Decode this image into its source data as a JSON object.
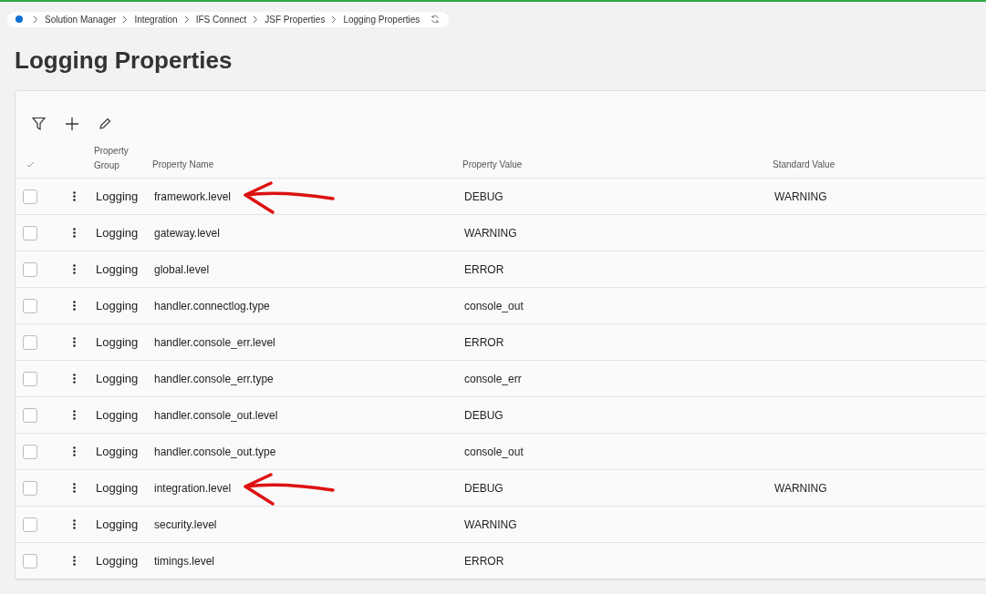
{
  "breadcrumb": [
    "Solution Manager",
    "Integration",
    "IFS Connect",
    "JSF Properties",
    "Logging Properties"
  ],
  "title": "Logging Properties",
  "table": {
    "columns": [
      "Property Group",
      "Property Name",
      "Property Value",
      "Standard Value"
    ],
    "rows": [
      {
        "checked": false,
        "group": "Logging",
        "name": "framework.level",
        "value": "DEBUG",
        "standard": "WARNING",
        "marked": true
      },
      {
        "checked": false,
        "group": "Logging",
        "name": "gateway.level",
        "value": "WARNING",
        "standard": "",
        "marked": false
      },
      {
        "checked": false,
        "group": "Logging",
        "name": "global.level",
        "value": "ERROR",
        "standard": "",
        "marked": false
      },
      {
        "checked": false,
        "group": "Logging",
        "name": "handler.connectlog.type",
        "value": "console_out",
        "standard": "",
        "marked": false
      },
      {
        "checked": false,
        "group": "Logging",
        "name": "handler.console_err.level",
        "value": "ERROR",
        "standard": "",
        "marked": false
      },
      {
        "checked": false,
        "group": "Logging",
        "name": "handler.console_err.type",
        "value": "console_err",
        "standard": "",
        "marked": false
      },
      {
        "checked": false,
        "group": "Logging",
        "name": "handler.console_out.level",
        "value": "DEBUG",
        "standard": "",
        "marked": false
      },
      {
        "checked": false,
        "group": "Logging",
        "name": "handler.console_out.type",
        "value": "console_out",
        "standard": "",
        "marked": false
      },
      {
        "checked": false,
        "group": "Logging",
        "name": "integration.level",
        "value": "DEBUG",
        "standard": "WARNING",
        "marked": true
      },
      {
        "checked": false,
        "group": "Logging",
        "name": "security.level",
        "value": "WARNING",
        "standard": "",
        "marked": false
      },
      {
        "checked": false,
        "group": "Logging",
        "name": "timings.level",
        "value": "ERROR",
        "standard": "",
        "marked": false
      }
    ]
  }
}
